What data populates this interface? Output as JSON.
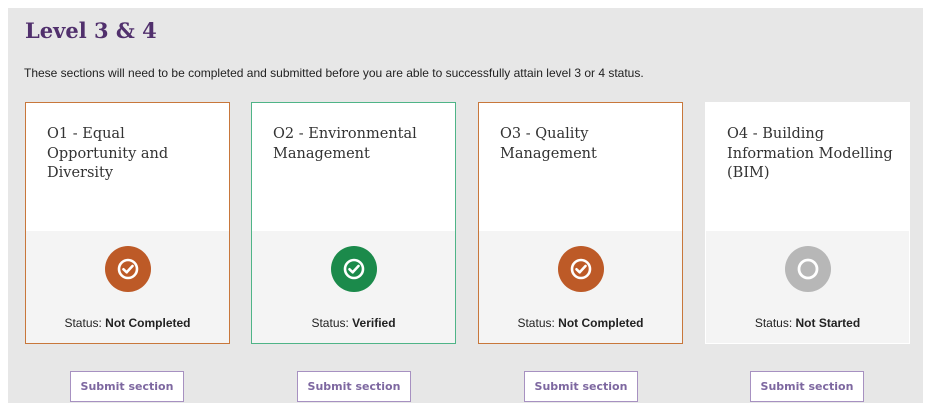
{
  "page": {
    "title": "Level 3 & 4",
    "intro": "These sections will need to be completed and submitted before you are able to successfully attain level 3 or 4 status."
  },
  "status_label": "Status:",
  "sections": [
    {
      "name": "O1 - Equal Opportunity and Diversity",
      "status": "Not Completed",
      "icon": "check-circle-icon",
      "accent": "#bd5a27",
      "border": "#c8773b",
      "button": "Submit section"
    },
    {
      "name": "O2 - Environmental Management",
      "status": "Verified",
      "icon": "check-circle-icon",
      "accent": "#1b8a4b",
      "border": "#4fb487",
      "button": "Submit section"
    },
    {
      "name": "O3 - Quality Management",
      "status": "Not Completed",
      "icon": "check-circle-icon",
      "accent": "#bd5a27",
      "border": "#c8773b",
      "button": "Submit section"
    },
    {
      "name": "O4 - Building Information Modelling (BIM)",
      "status": "Not Started",
      "icon": "empty-circle-icon",
      "accent": "#b7b7b7",
      "border": "#ffffff",
      "button": "Submit section"
    }
  ],
  "colors": {
    "title": "#51306d",
    "button_text": "#7d67a0",
    "button_border": "#a791c1",
    "panel_bg": "#e7e7e7"
  }
}
